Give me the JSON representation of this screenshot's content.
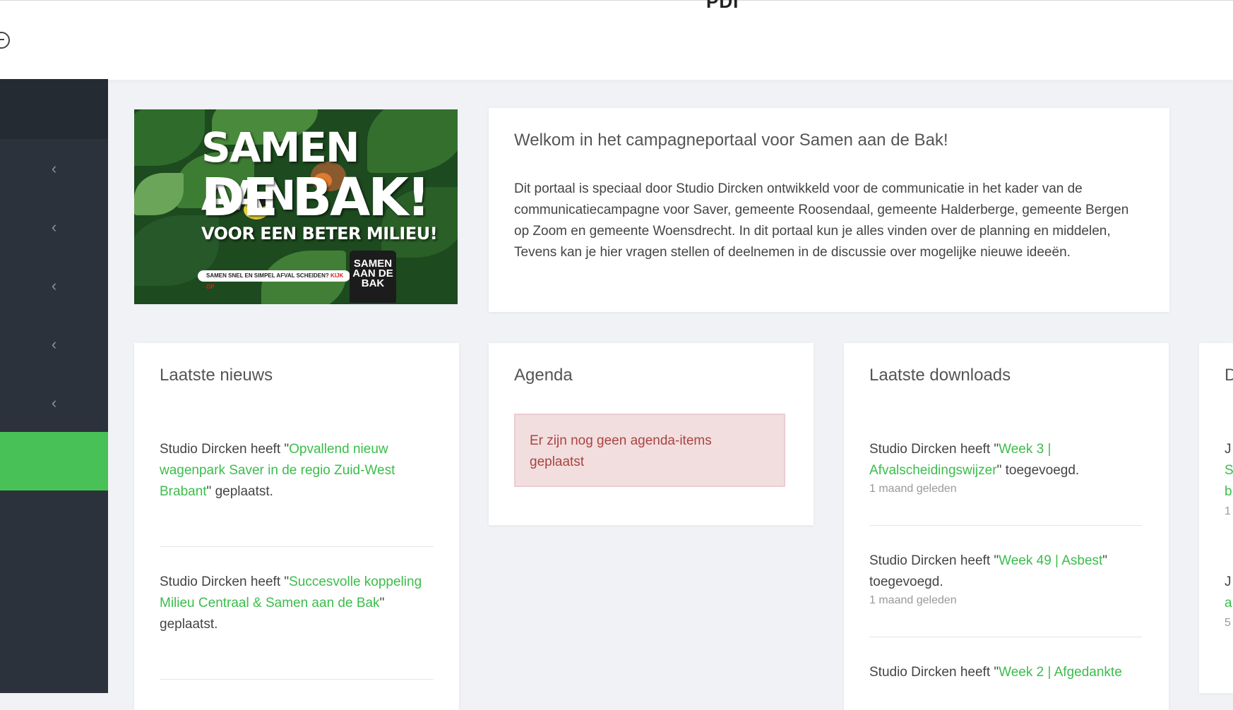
{
  "header": {
    "logo_partial": "PDI",
    "logout_icon": "logout-icon"
  },
  "sidebar": {
    "items": [
      {
        "icon": "chevron-left-icon",
        "glyph": "‹"
      },
      {
        "icon": "chevron-left-icon",
        "glyph": "‹"
      },
      {
        "icon": "chevron-left-icon",
        "glyph": "‹"
      },
      {
        "icon": "chevron-left-icon",
        "glyph": "‹"
      },
      {
        "icon": "chevron-left-icon",
        "glyph": "‹"
      }
    ],
    "active_color": "#48c156"
  },
  "banner": {
    "line1": "SAMEN AAN",
    "line2": "DE BAK!",
    "line3": "VOOR EEN BETER MILIEU!",
    "strip": "SAMEN SNEL EN SIMPEL AFVAL SCHEIDEN?",
    "strip_red": " KIJK OP",
    "bin_text": "SAMEN AAN DE BAK"
  },
  "welcome": {
    "title": "Welkom in het campagneportaal voor Samen aan de Bak!",
    "body": "Dit portaal is speciaal door Studio Dircken ontwikkeld voor de communicatie in het kader van de communicatiecampagne voor Saver, gemeente Roosendaal, gemeente Halderberge, gemeente Bergen op Zoom en gemeente Woensdrecht. In dit portaal kun je alles vinden over de planning en middelen, Tevens kan je hier vragen stellen of deelnemen in de discussie over mogelijke nieuwe ideeën."
  },
  "news": {
    "title": "Laatste nieuws",
    "items": [
      {
        "prefix": "Studio Dircken heeft \"",
        "link": "Opvallend nieuw wagenpark Saver in de regio Zuid-West Brabant",
        "suffix": "\" geplaatst."
      },
      {
        "prefix": "Studio Dircken heeft \"",
        "link": "Succesvolle koppeling Milieu Centraal & Samen aan de Bak",
        "suffix": "\" geplaatst."
      }
    ]
  },
  "agenda": {
    "title": "Agenda",
    "empty": "Er zijn nog geen agenda-items geplaatst"
  },
  "downloads": {
    "title": "Laatste downloads",
    "items": [
      {
        "prefix": "Studio Dircken heeft \"",
        "link": "Week 3 | Afvalscheidingswijzer",
        "suffix": "\" toegevoegd.",
        "time": "1 maand geleden"
      },
      {
        "prefix": "Studio Dircken heeft \"",
        "link": "Week 49 | Asbest",
        "suffix": "\" toegevoegd.",
        "time": "1 maand geleden"
      },
      {
        "prefix": "Studio Dircken heeft \"",
        "link": "Week 2 | Afgedankte",
        "suffix": "",
        "time": ""
      }
    ]
  },
  "partial_card": {
    "title": "D",
    "lines": [
      "J",
      "S",
      "b",
      "1",
      "J",
      "a",
      "5"
    ]
  },
  "colors": {
    "link": "#3bbd4b",
    "sidebar": "#2b323c",
    "alert_bg": "#f2dede",
    "alert_text": "#a94442"
  }
}
